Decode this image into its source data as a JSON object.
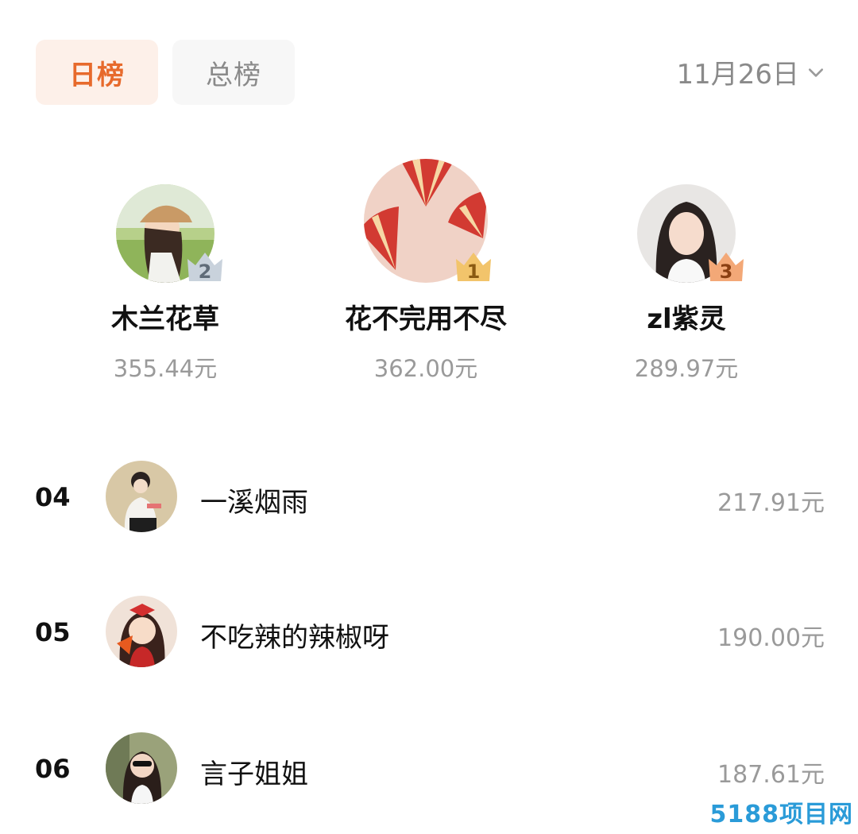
{
  "tabs": [
    {
      "label": "日榜",
      "active": true
    },
    {
      "label": "总榜",
      "active": false
    }
  ],
  "date_selector": {
    "value": "11月26日"
  },
  "podium": [
    {
      "rank": "2",
      "name": "木兰花草",
      "amount": "355.44元",
      "avatar": "girl-with-hat-avatar"
    },
    {
      "rank": "1",
      "name": "花不完用不尽",
      "amount": "362.00元",
      "avatar": "red-fans-avatar"
    },
    {
      "rank": "3",
      "name": "zl紫灵",
      "amount": "289.97元",
      "avatar": "girl-photo-avatar"
    }
  ],
  "list": [
    {
      "rank": "04",
      "name": "一溪烟雨",
      "amount": "217.91元"
    },
    {
      "rank": "05",
      "name": "不吃辣的辣椒呀",
      "amount": "190.00元"
    },
    {
      "rank": "06",
      "name": "言子姐姐",
      "amount": "187.61元"
    }
  ],
  "watermark": "5188项目网",
  "colors": {
    "accent": "#e76a2c",
    "gold": "#f2c46b",
    "silver": "#c9d2dc",
    "bronze": "#f3a877"
  }
}
